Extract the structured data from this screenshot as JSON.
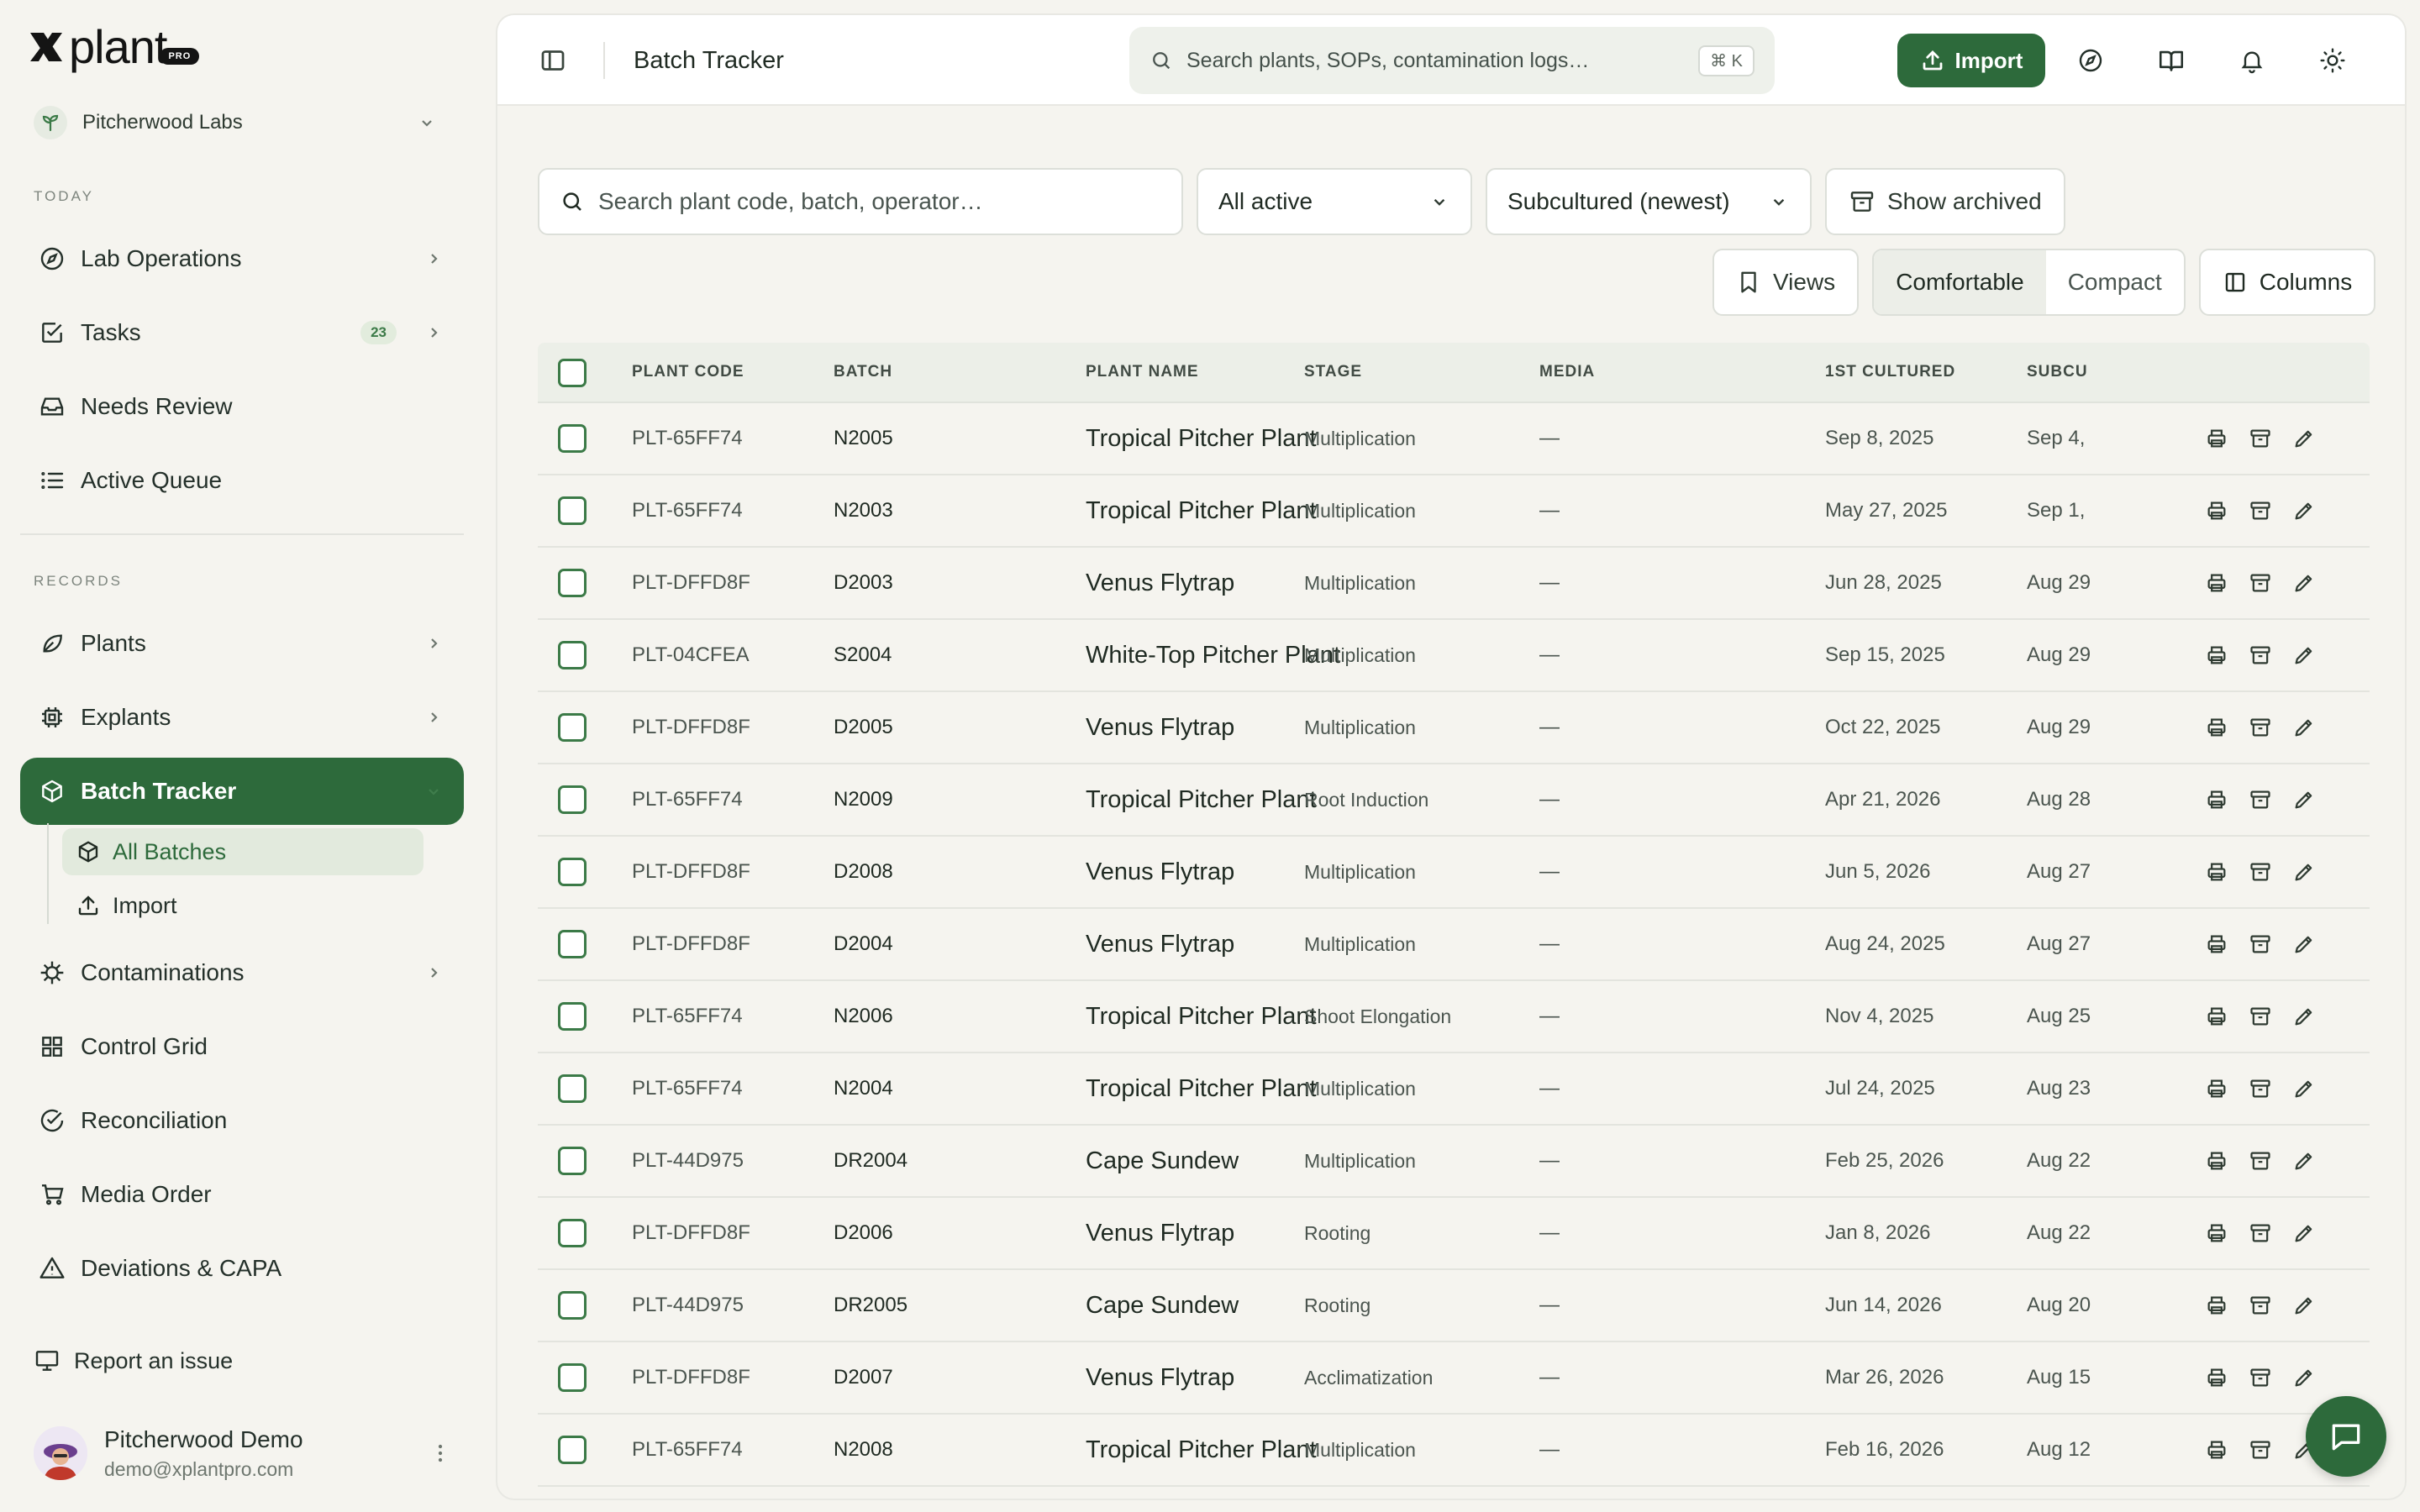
{
  "brand": {
    "name": "plant",
    "badge": "PRO"
  },
  "workspace": {
    "name": "Pitcherwood Labs"
  },
  "sidebar": {
    "today_label": "TODAY",
    "records_label": "RECORDS",
    "today_items": [
      {
        "label": "Lab Operations",
        "icon": "compass-icon"
      },
      {
        "label": "Tasks",
        "icon": "checkbox-icon",
        "count": "23"
      },
      {
        "label": "Needs Review",
        "icon": "inbox-icon"
      },
      {
        "label": "Active Queue",
        "icon": "list-icon"
      }
    ],
    "records_items": [
      {
        "label": "Plants",
        "icon": "leaf-icon"
      },
      {
        "label": "Explants",
        "icon": "chip-icon"
      },
      {
        "label": "Batch Tracker",
        "icon": "box-icon"
      },
      {
        "label": "Contaminations",
        "icon": "virus-icon"
      },
      {
        "label": "Control Grid",
        "icon": "grid-icon"
      },
      {
        "label": "Reconciliation",
        "icon": "check-circle-icon"
      },
      {
        "label": "Media Order",
        "icon": "cart-icon"
      },
      {
        "label": "Deviations & CAPA",
        "icon": "warning-icon"
      }
    ],
    "batch_sub": [
      {
        "label": "All Batches"
      },
      {
        "label": "Import"
      }
    ],
    "report": "Report an issue",
    "user": {
      "name": "Pitcherwood Demo",
      "email": "demo@xplantpro.com"
    }
  },
  "topbar": {
    "title": "Batch Tracker",
    "search_placeholder": "Search plants, SOPs, contamination logs…",
    "shortcut": "⌘ K",
    "import_label": "Import"
  },
  "filters": {
    "search_placeholder": "Search plant code, batch, operator…",
    "status": "All active",
    "sort": "Subcultured (newest)",
    "archived": "Show archived",
    "views": "Views",
    "density": [
      "Comfortable",
      "Compact"
    ],
    "density_selected": "Comfortable",
    "columns": "Columns"
  },
  "table": {
    "headers": [
      "PLANT CODE",
      "BATCH",
      "PLANT NAME",
      "STAGE",
      "MEDIA",
      "1ST CULTURED",
      "SUBCU"
    ],
    "rows": [
      {
        "code": "PLT-65FF74",
        "batch": "N2005",
        "name": "Tropical Pitcher Plant",
        "stage": "Multiplication",
        "media": "—",
        "first": "Sep 8, 2025",
        "sub": "Sep 4,"
      },
      {
        "code": "PLT-65FF74",
        "batch": "N2003",
        "name": "Tropical Pitcher Plant",
        "stage": "Multiplication",
        "media": "—",
        "first": "May 27, 2025",
        "sub": "Sep 1,"
      },
      {
        "code": "PLT-DFFD8F",
        "batch": "D2003",
        "name": "Venus Flytrap",
        "stage": "Multiplication",
        "media": "—",
        "first": "Jun 28, 2025",
        "sub": "Aug 29"
      },
      {
        "code": "PLT-04CFEA",
        "batch": "S2004",
        "name": "White-Top Pitcher Plant",
        "stage": "Multiplication",
        "media": "—",
        "first": "Sep 15, 2025",
        "sub": "Aug 29"
      },
      {
        "code": "PLT-DFFD8F",
        "batch": "D2005",
        "name": "Venus Flytrap",
        "stage": "Multiplication",
        "media": "—",
        "first": "Oct 22, 2025",
        "sub": "Aug 29"
      },
      {
        "code": "PLT-65FF74",
        "batch": "N2009",
        "name": "Tropical Pitcher Plant",
        "stage": "Root Induction",
        "media": "—",
        "first": "Apr 21, 2026",
        "sub": "Aug 28"
      },
      {
        "code": "PLT-DFFD8F",
        "batch": "D2008",
        "name": "Venus Flytrap",
        "stage": "Multiplication",
        "media": "—",
        "first": "Jun 5, 2026",
        "sub": "Aug 27"
      },
      {
        "code": "PLT-DFFD8F",
        "batch": "D2004",
        "name": "Venus Flytrap",
        "stage": "Multiplication",
        "media": "—",
        "first": "Aug 24, 2025",
        "sub": "Aug 27"
      },
      {
        "code": "PLT-65FF74",
        "batch": "N2006",
        "name": "Tropical Pitcher Plant",
        "stage": "Shoot Elongation",
        "media": "—",
        "first": "Nov 4, 2025",
        "sub": "Aug 25"
      },
      {
        "code": "PLT-65FF74",
        "batch": "N2004",
        "name": "Tropical Pitcher Plant",
        "stage": "Multiplication",
        "media": "—",
        "first": "Jul 24, 2025",
        "sub": "Aug 23"
      },
      {
        "code": "PLT-44D975",
        "batch": "DR2004",
        "name": "Cape Sundew",
        "stage": "Multiplication",
        "media": "—",
        "first": "Feb 25, 2026",
        "sub": "Aug 22"
      },
      {
        "code": "PLT-DFFD8F",
        "batch": "D2006",
        "name": "Venus Flytrap",
        "stage": "Rooting",
        "media": "—",
        "first": "Jan 8, 2026",
        "sub": "Aug 22"
      },
      {
        "code": "PLT-44D975",
        "batch": "DR2005",
        "name": "Cape Sundew",
        "stage": "Rooting",
        "media": "—",
        "first": "Jun 14, 2026",
        "sub": "Aug 20"
      },
      {
        "code": "PLT-DFFD8F",
        "batch": "D2007",
        "name": "Venus Flytrap",
        "stage": "Acclimatization",
        "media": "—",
        "first": "Mar 26, 2026",
        "sub": "Aug 15"
      },
      {
        "code": "PLT-65FF74",
        "batch": "N2008",
        "name": "Tropical Pitcher Plant",
        "stage": "Multiplication",
        "media": "—",
        "first": "Feb 16, 2026",
        "sub": "Aug 12"
      }
    ]
  },
  "colors": {
    "accent": "#2d6a3b",
    "background": "#f5f4ef"
  }
}
